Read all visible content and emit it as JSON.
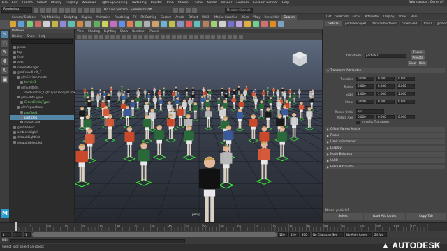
{
  "menubar": {
    "items": [
      "File",
      "Edit",
      "Create",
      "Select",
      "Modify",
      "Display",
      "Windows",
      "Lighting/Shading",
      "Texturing",
      "Render",
      "Toon",
      "Stereo",
      "Cache",
      "Arnold",
      "mGear",
      "Golaem",
      "Golaem Render",
      "Help"
    ],
    "workspace": "Workspace : General*"
  },
  "statusline": {
    "mode": "Rendering",
    "no_live_surface": "No Live Surface",
    "symmetry": "Symmetry: Off",
    "render_field": "Monster Chanels"
  },
  "shelf": {
    "tabs": [
      "Curves / Surfaces",
      "Poly Modeling",
      "Sculpting",
      "Rigging",
      "Animation",
      "Rendering",
      "FX",
      "FX Caching",
      "Custom",
      "Arnold",
      "Bifrost",
      "MASH",
      "Motion Graphics",
      "XGen",
      "VRay",
      "UnrealMult",
      "Golaem"
    ],
    "active_tab": "Golaem",
    "icon_colors": [
      "#d9a53b",
      "#5aa0d0",
      "#7acc7a",
      "#c86a6a",
      "#d0d0d0",
      "#c8b04a",
      "#8a8ad8",
      "#5fc0b0",
      "#d08a40",
      "#a0a0a0",
      "#60b060",
      "#d0d060",
      "#c070c0",
      "#6090e0",
      "#e08050",
      "#80c080",
      "#b0b0b0",
      "#d0a070",
      "#70b0d0",
      "#c0c050",
      "#9090c0",
      "#e06060",
      "#60c0c0",
      "#b08060",
      "#a0d070",
      "#d0d0d0",
      "#7070d0",
      "#c0a0e0",
      "#e0b040",
      "#70d090",
      "#d07070",
      "#e08a20",
      "#80a0c0"
    ]
  },
  "toolbox": {
    "tools": [
      "select-tool",
      "lasso-tool",
      "paint-tool",
      "move-tool",
      "rotate-tool",
      "scale-tool"
    ],
    "logo": "M"
  },
  "outliner": {
    "title": "Outliner",
    "menu": [
      "Display",
      "Show",
      "Help"
    ],
    "rows": [
      {
        "label": "persp",
        "indent": 1,
        "state": "normal"
      },
      {
        "label": "top",
        "indent": 1,
        "state": "normal"
      },
      {
        "label": "front",
        "indent": 1,
        "state": "normal"
      },
      {
        "label": "side",
        "indent": 1,
        "state": "normal"
      },
      {
        "label": "crowdManager",
        "indent": 1,
        "state": "normal"
      },
      {
        "label": "glmCrowdUnit_1",
        "indent": 1,
        "state": "normal"
      },
      {
        "label": "glmEnvironments",
        "indent": 2,
        "state": "normal"
      },
      {
        "label": "terrain1",
        "indent": 3,
        "state": "green"
      },
      {
        "label": "glmEmitters",
        "indent": 2,
        "state": "normal"
      },
      {
        "label": "CrowdEmitter_LightType1ShapeCrowd...",
        "indent": 3,
        "state": "normal"
      },
      {
        "label": "glmEntityTypes",
        "indent": 2,
        "state": "normal"
      },
      {
        "label": "CrowdEntityType1",
        "indent": 3,
        "state": "green"
      },
      {
        "label": "glmPopulations",
        "indent": 2,
        "state": "normal"
      },
      {
        "label": "popTool1",
        "indent": 3,
        "state": "green"
      },
      {
        "label": "particle1",
        "indent": 3,
        "state": "selected"
      },
      {
        "label": "crowdField1",
        "indent": 3,
        "state": "normal"
      },
      {
        "label": "glmShaders",
        "indent": 1,
        "state": "normal"
      },
      {
        "label": "ambientLight1",
        "indent": 1,
        "state": "normal"
      },
      {
        "label": "defaultLightSet",
        "indent": 1,
        "state": "normal"
      },
      {
        "label": "defaultObjectSet",
        "indent": 1,
        "state": "normal"
      }
    ]
  },
  "viewport": {
    "menu": [
      "View",
      "Shading",
      "Lighting",
      "Show",
      "Renderer",
      "Panels"
    ],
    "camera_label": "persp"
  },
  "attribute_editor": {
    "menu": [
      "List",
      "Selected",
      "Focus",
      "Attributes",
      "Display",
      "Show",
      "Help"
    ],
    "tabs": [
      "particle1",
      "particleShape1",
      "standardSurface1",
      "crowdField1",
      "time1",
      "glmPopul..."
    ],
    "active_tab": "particle1",
    "transform_label": "transform:",
    "node_name": "particle1",
    "focus_button": "Focus",
    "presets_button": "Presets",
    "show_button": "Show",
    "hide_button": "Hide",
    "transform_section": "Transform Attributes",
    "attrs": [
      {
        "label": "Translate",
        "values": [
          "0.000",
          "0.000",
          "0.000"
        ]
      },
      {
        "label": "Rotate",
        "values": [
          "0.000",
          "0.000",
          "0.000"
        ]
      },
      {
        "label": "Scale",
        "values": [
          "1.000",
          "1.000",
          "1.000"
        ]
      },
      {
        "label": "Shear",
        "values": [
          "0.000",
          "0.000",
          "0.000"
        ]
      }
    ],
    "rotate_order_label": "Rotate Order",
    "rotate_order_value": "xyz",
    "rotate_axis_label": "Rotate Axis",
    "rotate_axis_values": [
      "0.000",
      "0.000",
      "0.000"
    ],
    "inherits_label": "Inherits Transform",
    "sections": [
      "Offset Parent Matrix",
      "Pivots",
      "Limit Information",
      "Display",
      "Node Behavior",
      "UUID",
      "Extra Attributes"
    ],
    "notes_label": "Notes: particle1",
    "footer": [
      "Select",
      "Load Attributes",
      "Copy Tab"
    ]
  },
  "timeline": {
    "ticks": [
      "5",
      "10",
      "15",
      "20",
      "25",
      "30",
      "35",
      "40",
      "45",
      "50",
      "55",
      "60",
      "65",
      "70",
      "75",
      "80",
      "85",
      "90",
      "95",
      "100",
      "105",
      "110",
      "115",
      "120"
    ],
    "current_frame": "1"
  },
  "rangebar": {
    "start": "1",
    "range_start": "1",
    "range_end": "120",
    "end": "120",
    "end2": "200",
    "char_set": "No Character Set",
    "anim_layer": "No Anim Layer",
    "fps": "24 fps"
  },
  "cmdline": {
    "label": "MEL"
  },
  "helpline": {
    "text": "Select Tool: select an object"
  },
  "brand": {
    "text": "AUTODESK"
  },
  "characters": {
    "shirt_colors": [
      "#c84a2a",
      "#1a1a1a",
      "#d2d2d2",
      "#2a6a3a",
      "#3a5a9a",
      "#d65a3a",
      "#b8b8b8"
    ]
  }
}
